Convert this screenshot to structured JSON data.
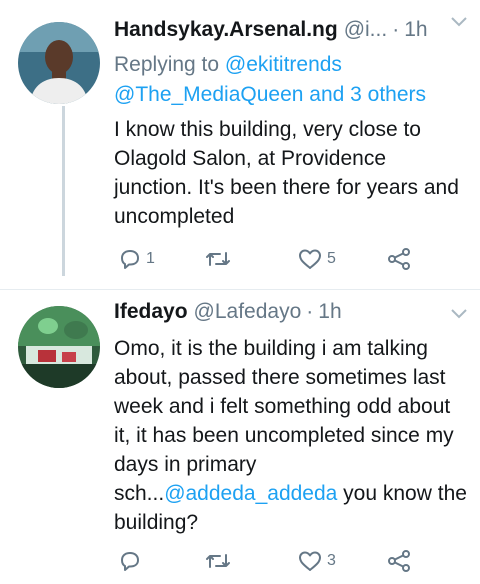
{
  "tweets": [
    {
      "name": "Handsykay.Arsenal.ng",
      "handle": "@i...",
      "separator": "·",
      "time": "1h",
      "reply_prefix": "Replying to",
      "reply_mention_1": "@ekititrends",
      "reply_mention_2": "@The_MediaQueen and 3 others",
      "text": "I know this building, very close to Olagold Salon, at Providence junction. It's been there for years and uncompleted",
      "reply_count": "1",
      "retweet_count": "",
      "like_count": "5"
    },
    {
      "name": "Ifedayo",
      "handle": "@Lafedayo",
      "separator": "·",
      "time": "1h",
      "text_before": "Omo, it is the building i am talking about, passed there sometimes last week and i felt something odd about it, it has been uncompleted since my days in primary sch...",
      "text_mention": "@addeda_addeda",
      "text_after": " you know the building?",
      "reply_count": "",
      "retweet_count": "",
      "like_count": "3"
    }
  ],
  "colors": {
    "link": "#1da1f2",
    "muted": "#657786",
    "text": "#14171a"
  },
  "icons": [
    "reply-icon",
    "retweet-icon",
    "like-icon",
    "share-icon",
    "chevron-down-icon"
  ]
}
